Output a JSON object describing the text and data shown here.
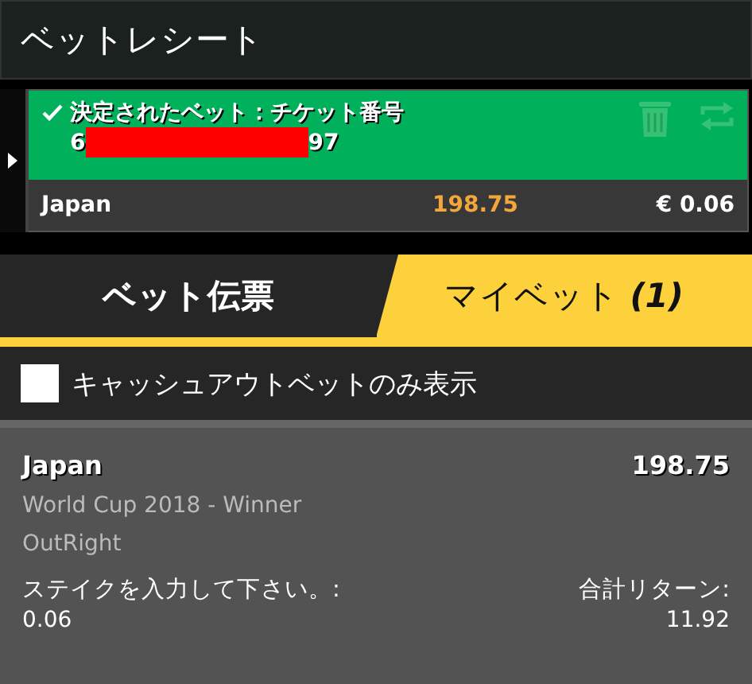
{
  "header": {
    "title": "ベットレシート"
  },
  "receipt": {
    "expanded": true,
    "status": "決定されたベット：チケット番号",
    "ticket_start": "6",
    "ticket_end": "97",
    "selection": "Japan",
    "odds": "198.75",
    "stake": "€ 0.06"
  },
  "tabs": [
    {
      "label": "ベット伝票",
      "selected": false
    },
    {
      "label": "マイベット",
      "count": "(1)",
      "selected": true
    }
  ],
  "filter": {
    "label": "キャッシュアウトベットのみ表示",
    "checked": false
  },
  "bets": [
    {
      "selection": "Japan",
      "odds": "198.75",
      "market": "World Cup 2018 - Winner",
      "type": "OutRight",
      "stake_label": "ステイクを入力して下さい。:",
      "stake": "0.06",
      "return_label": "合計リターン:",
      "return": "11.92"
    }
  ]
}
